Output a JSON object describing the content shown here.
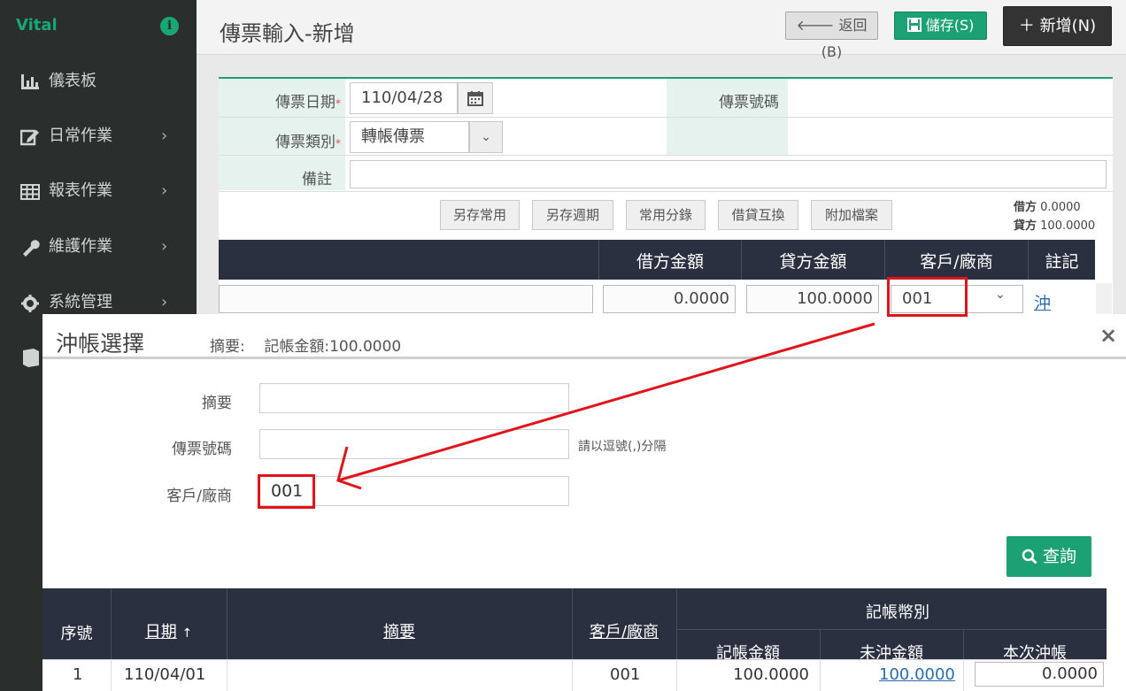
{
  "sidebar": {
    "brand": "Vital",
    "items": [
      {
        "label": "儀表板",
        "icon": "bar-chart-icon",
        "has_children": false
      },
      {
        "label": "日常作業",
        "icon": "edit-icon",
        "has_children": true
      },
      {
        "label": "報表作業",
        "icon": "table-icon",
        "has_children": true
      },
      {
        "label": "維護作業",
        "icon": "wrench-icon",
        "has_children": true
      },
      {
        "label": "系統管理",
        "icon": "gear-icon",
        "has_children": true
      }
    ],
    "chevron": "›"
  },
  "header": {
    "title": "傳票輸入-新增",
    "back_label": "返回(B)",
    "save_label": "儲存(S)",
    "new_label": "新增(N)"
  },
  "form": {
    "date_label": "傳票日期",
    "date_value": "110/04/28",
    "voucher_no_label": "傳票號碼",
    "type_label": "傳票類別",
    "type_value": "轉帳傳票",
    "note_label": "備註",
    "required_mark": "*"
  },
  "toolbar": {
    "buttons": [
      "另存常用",
      "另存週期",
      "常用分錄",
      "借貸互換",
      "附加檔案"
    ]
  },
  "totals": {
    "debit_label": "借方",
    "debit_value": "0.0000",
    "credit_label": "貸方",
    "credit_value": "100.0000"
  },
  "grid": {
    "headers": [
      "借方金額",
      "貸方金額",
      "客戶/廠商",
      "註記"
    ],
    "row": {
      "debit": "0.0000",
      "credit": "100.0000",
      "customer": "001",
      "mark": "沖"
    }
  },
  "modal": {
    "title": "沖帳選擇",
    "summary_label": "摘要:",
    "amount_text": "記帳金額:100.0000",
    "close": "×",
    "fields": {
      "summary_label": "摘要",
      "summary_value": "",
      "voucher_no_label": "傳票號碼",
      "voucher_no_value": "",
      "voucher_no_hint": "請以逗號(,)分隔",
      "customer_label": "客戶/廠商",
      "customer_value": "001"
    },
    "search_label": "查詢",
    "table": {
      "headers": {
        "seq": "序號",
        "date": "日期",
        "sort_indicator": "↑",
        "summary": "摘要",
        "customer": "客戶/廠商",
        "currency_group": "記帳幣別",
        "amount": "記帳金額",
        "unsettled": "未沖金額",
        "this_settle": "本次沖帳"
      },
      "rows": [
        {
          "seq": "1",
          "date": "110/04/01",
          "summary": "",
          "customer": "001",
          "amount": "100.0000",
          "unsettled": "100.0000",
          "this_settle": "0.0000"
        }
      ]
    }
  },
  "colors": {
    "sidebar_bg": "#2a2f2e",
    "accent_green": "#1ba174",
    "grid_header_bg": "#2b3040",
    "annotation_red": "#e0151b"
  }
}
